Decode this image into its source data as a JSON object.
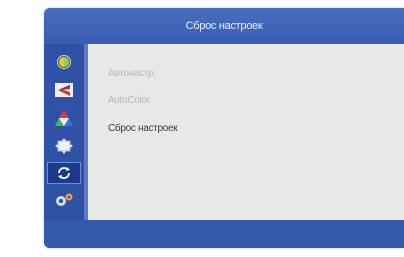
{
  "osd": {
    "title": "Сброс настроек",
    "colors": {
      "frame": "#3b5fb4",
      "sidebar": "#2f52a6",
      "content": "#e8e8e6",
      "active_highlight": "#1b3a8c"
    }
  },
  "sidebar": {
    "items": [
      {
        "icon": "brightness-icon"
      },
      {
        "icon": "image-adjust-icon"
      },
      {
        "icon": "color-icon"
      },
      {
        "icon": "position-icon"
      },
      {
        "icon": "reset-icon",
        "active": true
      },
      {
        "icon": "settings-icon"
      }
    ]
  },
  "menu": {
    "items": [
      {
        "label": "Автонастр.",
        "enabled": false
      },
      {
        "label": "AutoColor",
        "enabled": false
      },
      {
        "label": "Сброс настроек",
        "enabled": true
      }
    ]
  }
}
